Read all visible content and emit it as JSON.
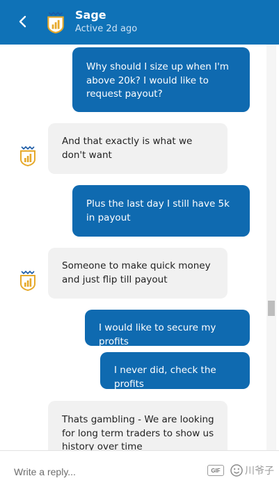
{
  "header": {
    "name": "Sage",
    "status": "Active 2d ago",
    "back_icon": "chevron-left-icon",
    "logo_icon": "sage-shield-logo",
    "background": "#0f72b7"
  },
  "messages": [
    {
      "direction": "outgoing",
      "text": "Why should I size up when I'm above 20k? I would like to request payout?"
    },
    {
      "direction": "incoming",
      "text": "And that exactly is what we don't want"
    },
    {
      "direction": "outgoing",
      "text": "Plus the last day I still have 5k in payout"
    },
    {
      "direction": "incoming",
      "text": "Someone to make quick money and just flip till payout"
    },
    {
      "direction": "outgoing",
      "text": "I would like to secure my profits"
    },
    {
      "direction": "outgoing",
      "text": "I never did, check the profits"
    },
    {
      "direction": "incoming",
      "text": "Thats gambling - We are looking for long term traders to show us history over time"
    }
  ],
  "composer": {
    "placeholder": "Write a reply...",
    "gif_label": "GIF",
    "emoji_icon": "emoji-icon"
  },
  "colors": {
    "outgoing_bubble": "#0f6ab0",
    "incoming_bubble": "#f1f1f1",
    "logo_gold": "#e6a92b"
  }
}
